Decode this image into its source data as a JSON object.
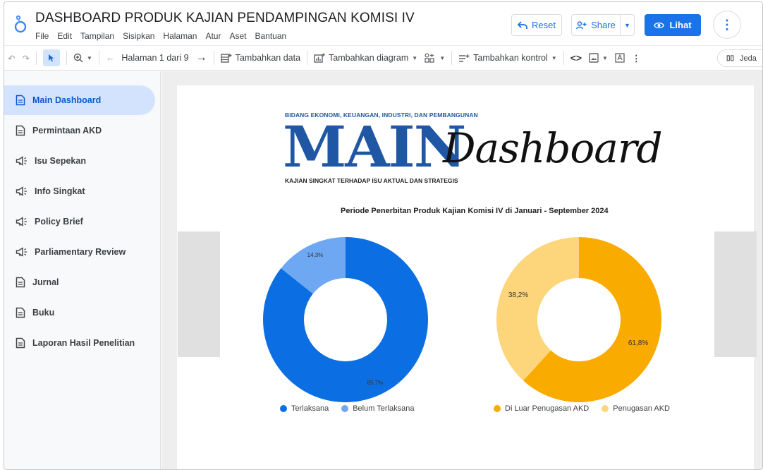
{
  "app": {
    "title": "DASHBOARD PRODUK KAJIAN PENDAMPINGAN KOMISI IV",
    "menu": [
      "File",
      "Edit",
      "Tampilan",
      "Sisipkan",
      "Halaman",
      "Atur",
      "Aset",
      "Bantuan"
    ],
    "reset_label": "Reset",
    "share_label": "Share",
    "lihat_label": "Lihat"
  },
  "toolbar": {
    "page_indicator": "Halaman 1 dari 9",
    "add_data": "Tambahkan data",
    "add_chart": "Tambahkan diagram",
    "add_control": "Tambahkan kontrol",
    "jeda": "Jeda"
  },
  "sidebar": {
    "items": [
      {
        "label": "Main Dashboard",
        "icon": "document-icon",
        "active": true
      },
      {
        "label": "Permintaan AKD",
        "icon": "document-icon",
        "active": false
      },
      {
        "label": "Isu Sepekan",
        "icon": "megaphone-icon",
        "active": false
      },
      {
        "label": "Info Singkat",
        "icon": "megaphone-icon",
        "active": false
      },
      {
        "label": "Policy Brief",
        "icon": "megaphone-icon",
        "active": false
      },
      {
        "label": "Parliamentary Review",
        "icon": "megaphone-icon",
        "active": false
      },
      {
        "label": "Jurnal",
        "icon": "document-icon",
        "active": false
      },
      {
        "label": "Buku",
        "icon": "document-icon",
        "active": false
      },
      {
        "label": "Laporan Hasil Penelitian",
        "icon": "document-icon",
        "active": false
      }
    ]
  },
  "report": {
    "hero_top": "BIDANG EKONOMI, KEUANGAN, INDUSTRI, DAN PEMBANGUNAN",
    "hero_main": "MAIN",
    "hero_script": "Dashboard",
    "hero_sub": "KAJIAN SINGKAT TERHADAP ISU AKTUAL DAN STRATEGIS",
    "chart_title": "Periode Penerbitan Produk Kajian Komisi IV di Januari - September 2024"
  },
  "chart_data": [
    {
      "type": "pie",
      "donut": true,
      "categories": [
        "Terlaksana",
        "Belum Terlaksana"
      ],
      "values": [
        85.7,
        14.3
      ],
      "labels": [
        "85,7%",
        "14,3%"
      ],
      "colors": [
        "#0b6fe3",
        "#6ea8f2"
      ],
      "legend_position": "bottom"
    },
    {
      "type": "pie",
      "donut": true,
      "categories": [
        "Di Luar Penugasan AKD",
        "Penugasan AKD"
      ],
      "values": [
        61.8,
        38.2
      ],
      "labels": [
        "61,8%",
        "38,2%"
      ],
      "colors": [
        "#f9ab00",
        "#fdd57a"
      ],
      "legend_position": "bottom"
    }
  ],
  "colors": {
    "accent": "#1a73e8",
    "active_nav_bg": "#d3e3fd",
    "brand_blue": "#1f57a4"
  }
}
